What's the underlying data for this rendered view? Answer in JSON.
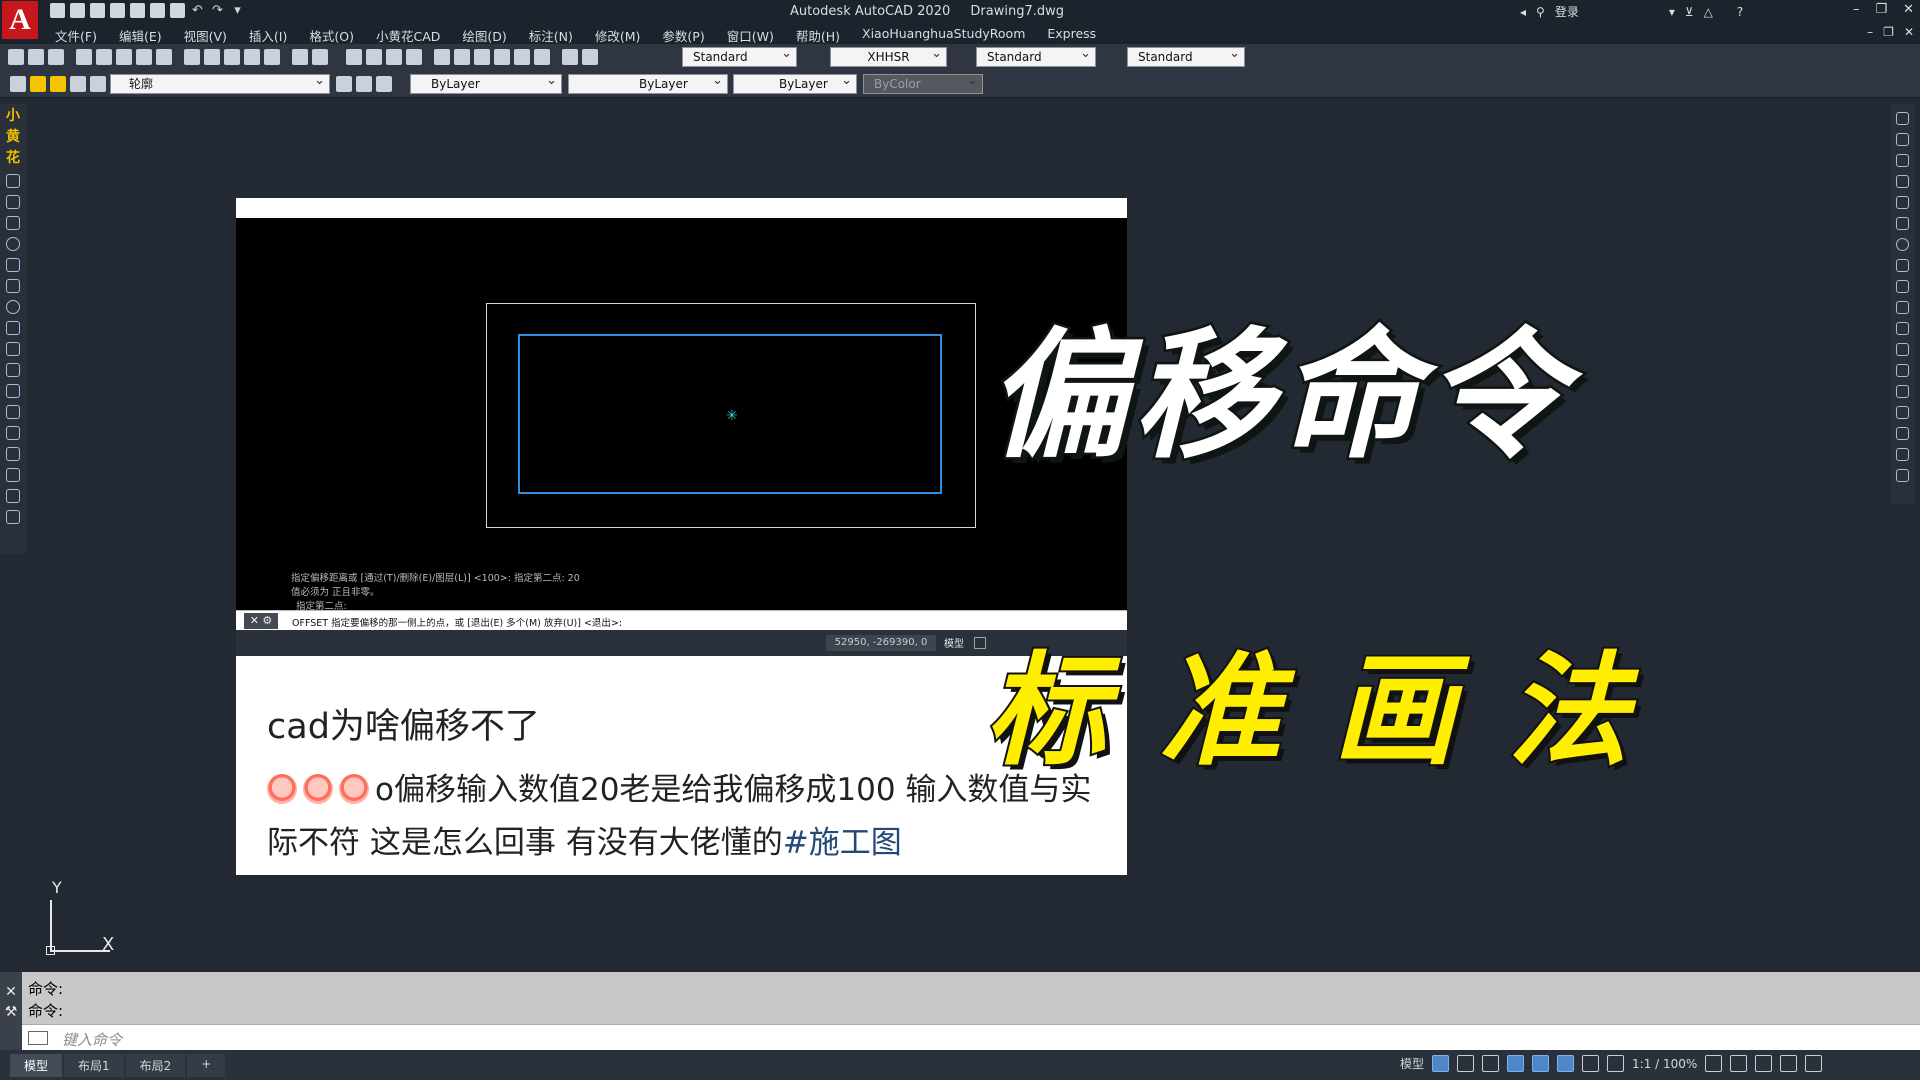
{
  "app": {
    "logo": "A",
    "name": "Autodesk AutoCAD 2020",
    "file": "Drawing7.dwg",
    "login": "登录"
  },
  "menu": [
    "文件(F)",
    "编辑(E)",
    "视图(V)",
    "插入(I)",
    "格式(O)",
    "小黄花CAD",
    "绘图(D)",
    "标注(N)",
    "修改(M)",
    "参数(P)",
    "窗口(W)",
    "帮助(H)",
    "XiaoHuanghuaStudyRoom",
    "Express"
  ],
  "toolbar": {
    "text_style": "Standard",
    "dim_style": "XHHSR",
    "table_style": "Standard",
    "multileader_style": "Standard",
    "layer": "轮廓",
    "color": "ByLayer",
    "linetype": "ByLayer",
    "lineweight": "ByLayer",
    "plot_style": "ByColor"
  },
  "left_tool_text": [
    "小",
    "黄",
    "花"
  ],
  "ucs": {
    "x": "X",
    "y": "Y"
  },
  "post": {
    "history": [
      "指定偏移距离或 [通过(T)/删除(E)/图层(L)] <100>:  指定第二点: 20",
      "值必须为 正且非零。",
      "指定第二点:"
    ],
    "command_prompt": "OFFSET 指定要偏移的那一侧上的点，或 [退出(E) 多个(M) 放弃(U)] <退出>:",
    "coords": "52950, -269390, 0",
    "mode": "模型",
    "title": "cad为啥偏移不了",
    "body": "o偏移输入数值20老是给我偏移成100 输入数值与实际不符 这是怎么回事 有没有大佬懂的",
    "tag": "#施工图"
  },
  "overlay": {
    "title": "偏移命令",
    "subtitle": "标准画法"
  },
  "command": {
    "history": [
      "命令:",
      "命令:"
    ],
    "placeholder": "键入命令"
  },
  "layout_tabs": [
    "模型",
    "布局1",
    "布局2",
    "+"
  ],
  "status": {
    "mode": "模型",
    "scale": "1:1 / 100%"
  }
}
